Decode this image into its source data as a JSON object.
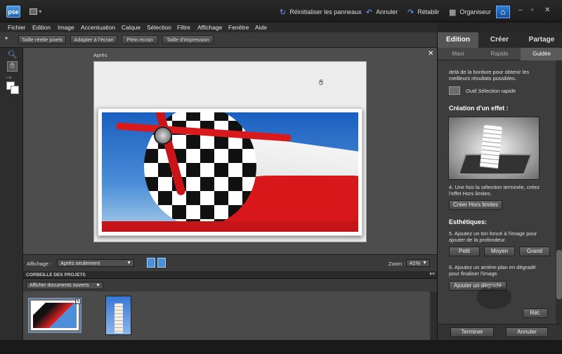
{
  "app": {
    "logo": "pse"
  },
  "titlebar": {
    "reset_panels": "Réinitialiser les panneaux",
    "undo": "Annuler",
    "redo": "Rétablir",
    "organizer": "Organiseur",
    "minimize": "–",
    "restore": "▫",
    "close": "✕"
  },
  "menu": [
    "Fichier",
    "Edition",
    "Image",
    "Accentuation",
    "Calque",
    "Sélection",
    "Filtre",
    "Affichage",
    "Fenêtre",
    "Aide"
  ],
  "options": {
    "actual_pixels": "Taille réelle pixels",
    "fit_screen": "Adapter à l'écran",
    "fill_screen": "Plein écran",
    "print_size": "Taille d'impression"
  },
  "document": {
    "title": "Après",
    "close": "✕"
  },
  "status": {
    "view_label": "Affichage :",
    "view_value": "Après seulement",
    "zoom_label": "Zoom :",
    "zoom_value": "41%"
  },
  "project_bin": {
    "title": "CORBEILLE DES PROJETS",
    "filter_value": "Afficher documents ouverts"
  },
  "panel": {
    "tabs": [
      "Edition",
      "Créer",
      "Partage"
    ],
    "subtabs": [
      "Maxi",
      "Rapide",
      "Guidée"
    ],
    "intro_line1": "delà de la bordure pour obtenir les",
    "intro_line2": "meilleurs résultats possibles.",
    "tool_label": "Outil Sélection rapide",
    "effect_heading": "Création d'un effet :",
    "step4_line1": "4. Une fois la sélection terminée, créez",
    "step4_line2": "l'effet Hors limites.",
    "create_button": "Créer Hors limites",
    "aesthetics_heading": "Esthétiques:",
    "step5_line1": "5. Ajoutez un ton foncé à l'image pour",
    "step5_line2": "ajouter de la profondeur.",
    "small": "Petit",
    "medium": "Moyen",
    "large": "Grand",
    "step6_line1": "6. Ajoutez un arrière-plan en dégradé",
    "step6_line2": "pour finaliser l'image.",
    "gradient_button": "Ajouter un dégradé",
    "reset_button": "Rét.",
    "done_button": "Terminer",
    "cancel_button": "Annuler"
  },
  "icons": {
    "zoom": "magnifier-icon",
    "hand": "hand-icon"
  },
  "colors": {
    "accent": "#2e7ed1",
    "panel": "#3c3c3c",
    "canvas": "#4d4d4d"
  }
}
